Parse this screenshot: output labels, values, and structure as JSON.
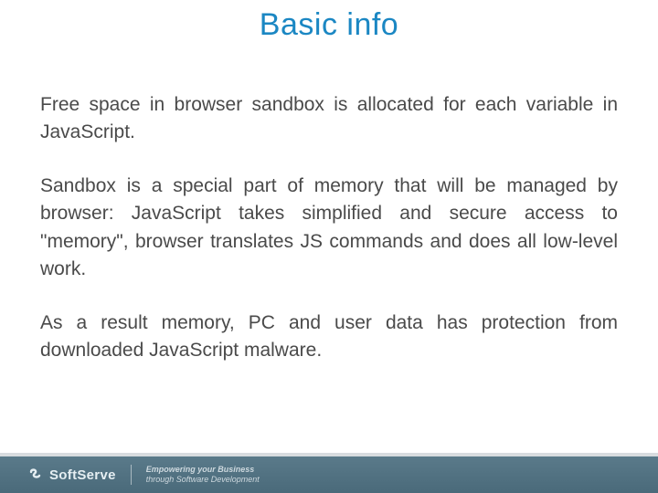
{
  "title": "Basic info",
  "paragraphs": [
    "Free space in browser sandbox is allocated for each variable in JavaScript.",
    "Sandbox is a special part of memory that will be managed by browser: JavaScript takes simplified and secure access to \"memory\", browser translates JS commands and does all low-level work.",
    "As a result memory, PC and user data has protection from downloaded JavaScript malware."
  ],
  "footer": {
    "brand": "SoftServe",
    "tagline_main": "Empowering your Business",
    "tagline_sub": "through Software Development"
  }
}
